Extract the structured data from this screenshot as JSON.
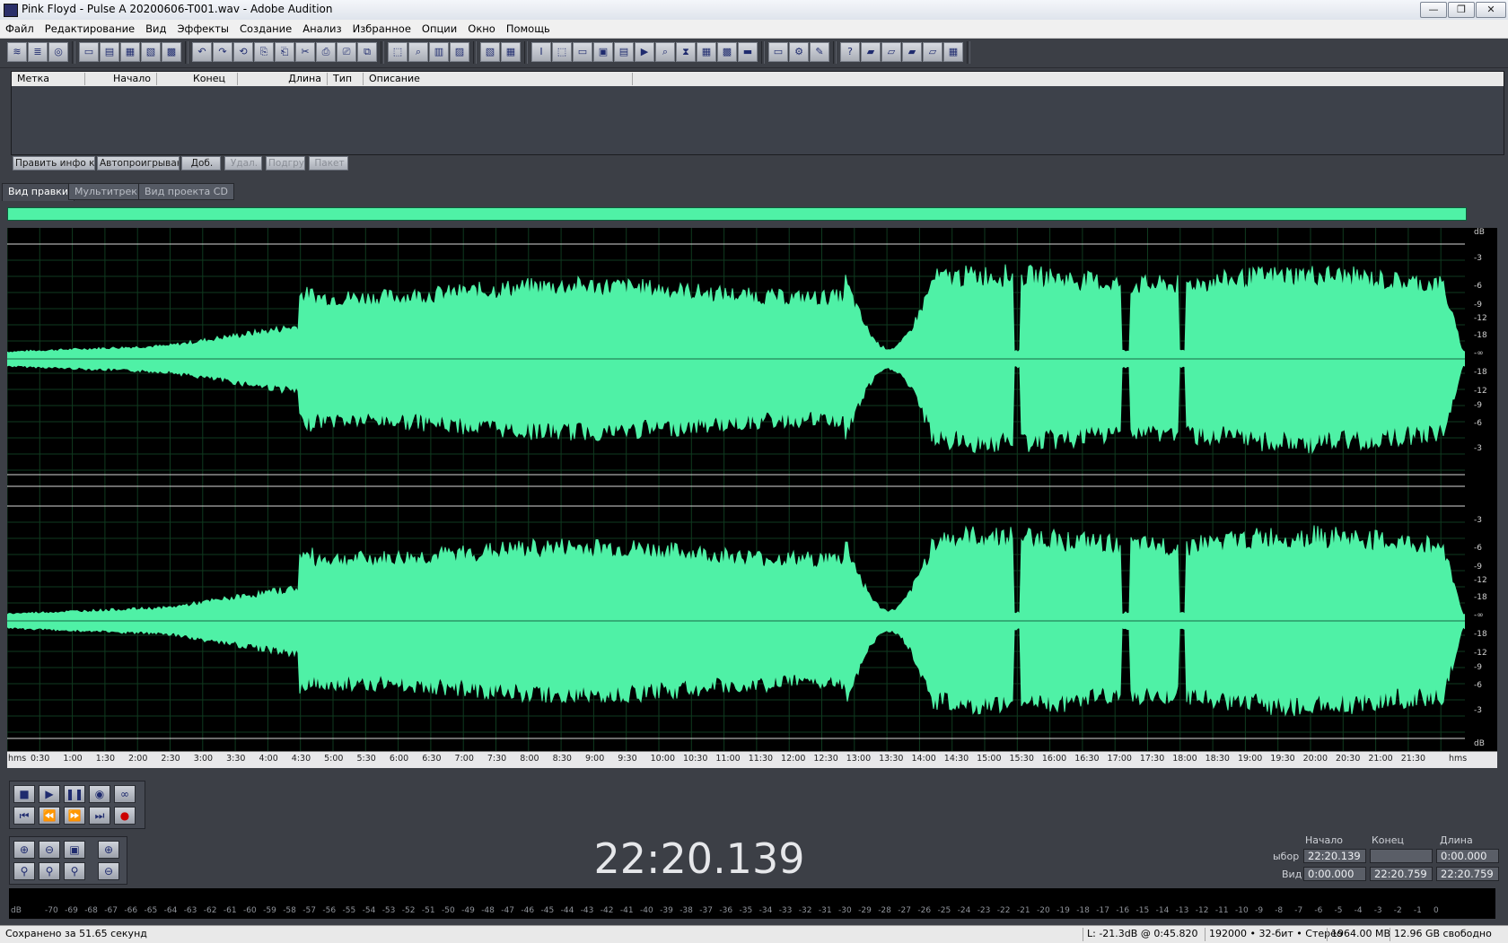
{
  "window": {
    "title": "Pink Floyd - Pulse  A 20200606-T001.wav - Adobe Audition"
  },
  "menu": [
    "Файл",
    "Редактирование",
    "Вид",
    "Эффекты",
    "Создание",
    "Анализ",
    "Избранное",
    "Опции",
    "Окно",
    "Помощь"
  ],
  "marker_list": {
    "columns": [
      "Метка",
      "Начало",
      "Конец",
      "Длина",
      "Тип",
      "Описание"
    ],
    "buttons": [
      "Править инфо кн",
      "Автопроигрывани",
      "Доб.",
      "Удал.",
      "Подгруз",
      "Пакет"
    ]
  },
  "tabs": [
    "Вид правки",
    "Мультитрек",
    "Вид проекта CD"
  ],
  "db_scale": {
    "top_label": "dB",
    "ch1": [
      "-3",
      "-6",
      "-9",
      "-12",
      "-18",
      "-∞",
      "-18",
      "-12",
      "-9",
      "-6",
      "-3"
    ],
    "ch2": [
      "-3",
      "-6",
      "-9",
      "-12",
      "-18",
      "-∞",
      "-18",
      "-12",
      "-9",
      "-6",
      "-3"
    ],
    "bottom_label": "dB"
  },
  "timeline": {
    "unit": "hms",
    "ticks": [
      "0:30",
      "1:00",
      "1:30",
      "2:00",
      "2:30",
      "3:00",
      "3:30",
      "4:00",
      "4:30",
      "5:00",
      "5:30",
      "6:00",
      "6:30",
      "7:00",
      "7:30",
      "8:00",
      "8:30",
      "9:00",
      "9:30",
      "10:00",
      "10:30",
      "11:00",
      "11:30",
      "12:00",
      "12:30",
      "13:00",
      "13:30",
      "14:00",
      "14:30",
      "15:00",
      "15:30",
      "16:00",
      "16:30",
      "17:00",
      "17:30",
      "18:00",
      "18:30",
      "19:00",
      "19:30",
      "20:00",
      "20:30",
      "21:00",
      "21:30"
    ],
    "end_label": "hms"
  },
  "time_display": "22:20.139",
  "selection": {
    "headers": [
      "Начало",
      "Конец",
      "Длина"
    ],
    "row_labels": [
      "ыбор",
      "Вид"
    ],
    "rows": [
      [
        "22:20.139",
        "",
        "0:00.000"
      ],
      [
        "0:00.000",
        "22:20.759",
        "22:20.759"
      ]
    ]
  },
  "meter": {
    "unit": "dB",
    "labels": [
      "-70",
      "-69",
      "-68",
      "-67",
      "-66",
      "-65",
      "-64",
      "-63",
      "-62",
      "-61",
      "-60",
      "-59",
      "-58",
      "-57",
      "-56",
      "-55",
      "-54",
      "-53",
      "-52",
      "-51",
      "-50",
      "-49",
      "-48",
      "-47",
      "-46",
      "-45",
      "-44",
      "-43",
      "-42",
      "-41",
      "-40",
      "-39",
      "-38",
      "-37",
      "-36",
      "-35",
      "-34",
      "-33",
      "-32",
      "-31",
      "-30",
      "-29",
      "-28",
      "-27",
      "-26",
      "-25",
      "-24",
      "-23",
      "-22",
      "-21",
      "-20",
      "-19",
      "-18",
      "-17",
      "-16",
      "-15",
      "-14",
      "-13",
      "-12",
      "-11",
      "-10",
      "-9",
      "-8",
      "-7",
      "-6",
      "-5",
      "-4",
      "-3",
      "-2",
      "-1",
      "0"
    ]
  },
  "status": {
    "saved": "Сохранено за 51.65 секунд",
    "level": "L: -21.3dB @   0:45.820",
    "format": "192000 • 32-бит • Стерео",
    "size": "1964.00 MB",
    "free": "12.96 GB свободно"
  },
  "colors": {
    "waveform": "#4ff1a6",
    "background": "#000000",
    "panel": "#3c3f46"
  },
  "icons": {
    "toolbar": [
      "waveform-view-icon",
      "multitrack-view-icon",
      "cd-view-icon",
      "new-file-icon",
      "open-file-icon",
      "save-icon",
      "save-as-icon",
      "close-file-icon",
      "undo-icon",
      "redo-icon",
      "repeat-icon",
      "copy-icon",
      "copy-new-icon",
      "cut-icon",
      "paste-icon",
      "paste-new-icon",
      "mix-paste-icon",
      "trim-icon",
      "zoom-icon",
      "spectral-icon",
      "frequency-icon",
      "phase-icon",
      "multi-icon",
      "time-select-icon",
      "marquee-icon",
      "window-1-icon",
      "window-2-icon",
      "window-3-icon",
      "window-4-icon",
      "window-5-icon",
      "window-6-icon",
      "window-7-icon",
      "window-8-icon",
      "window-9-icon",
      "window-10-icon",
      "settings-icon",
      "script-icon",
      "help-icon",
      "fx-1-icon",
      "fx-2-icon",
      "fx-3-icon",
      "fx-4-icon",
      "fx-5-icon",
      "fx-6-icon"
    ]
  }
}
